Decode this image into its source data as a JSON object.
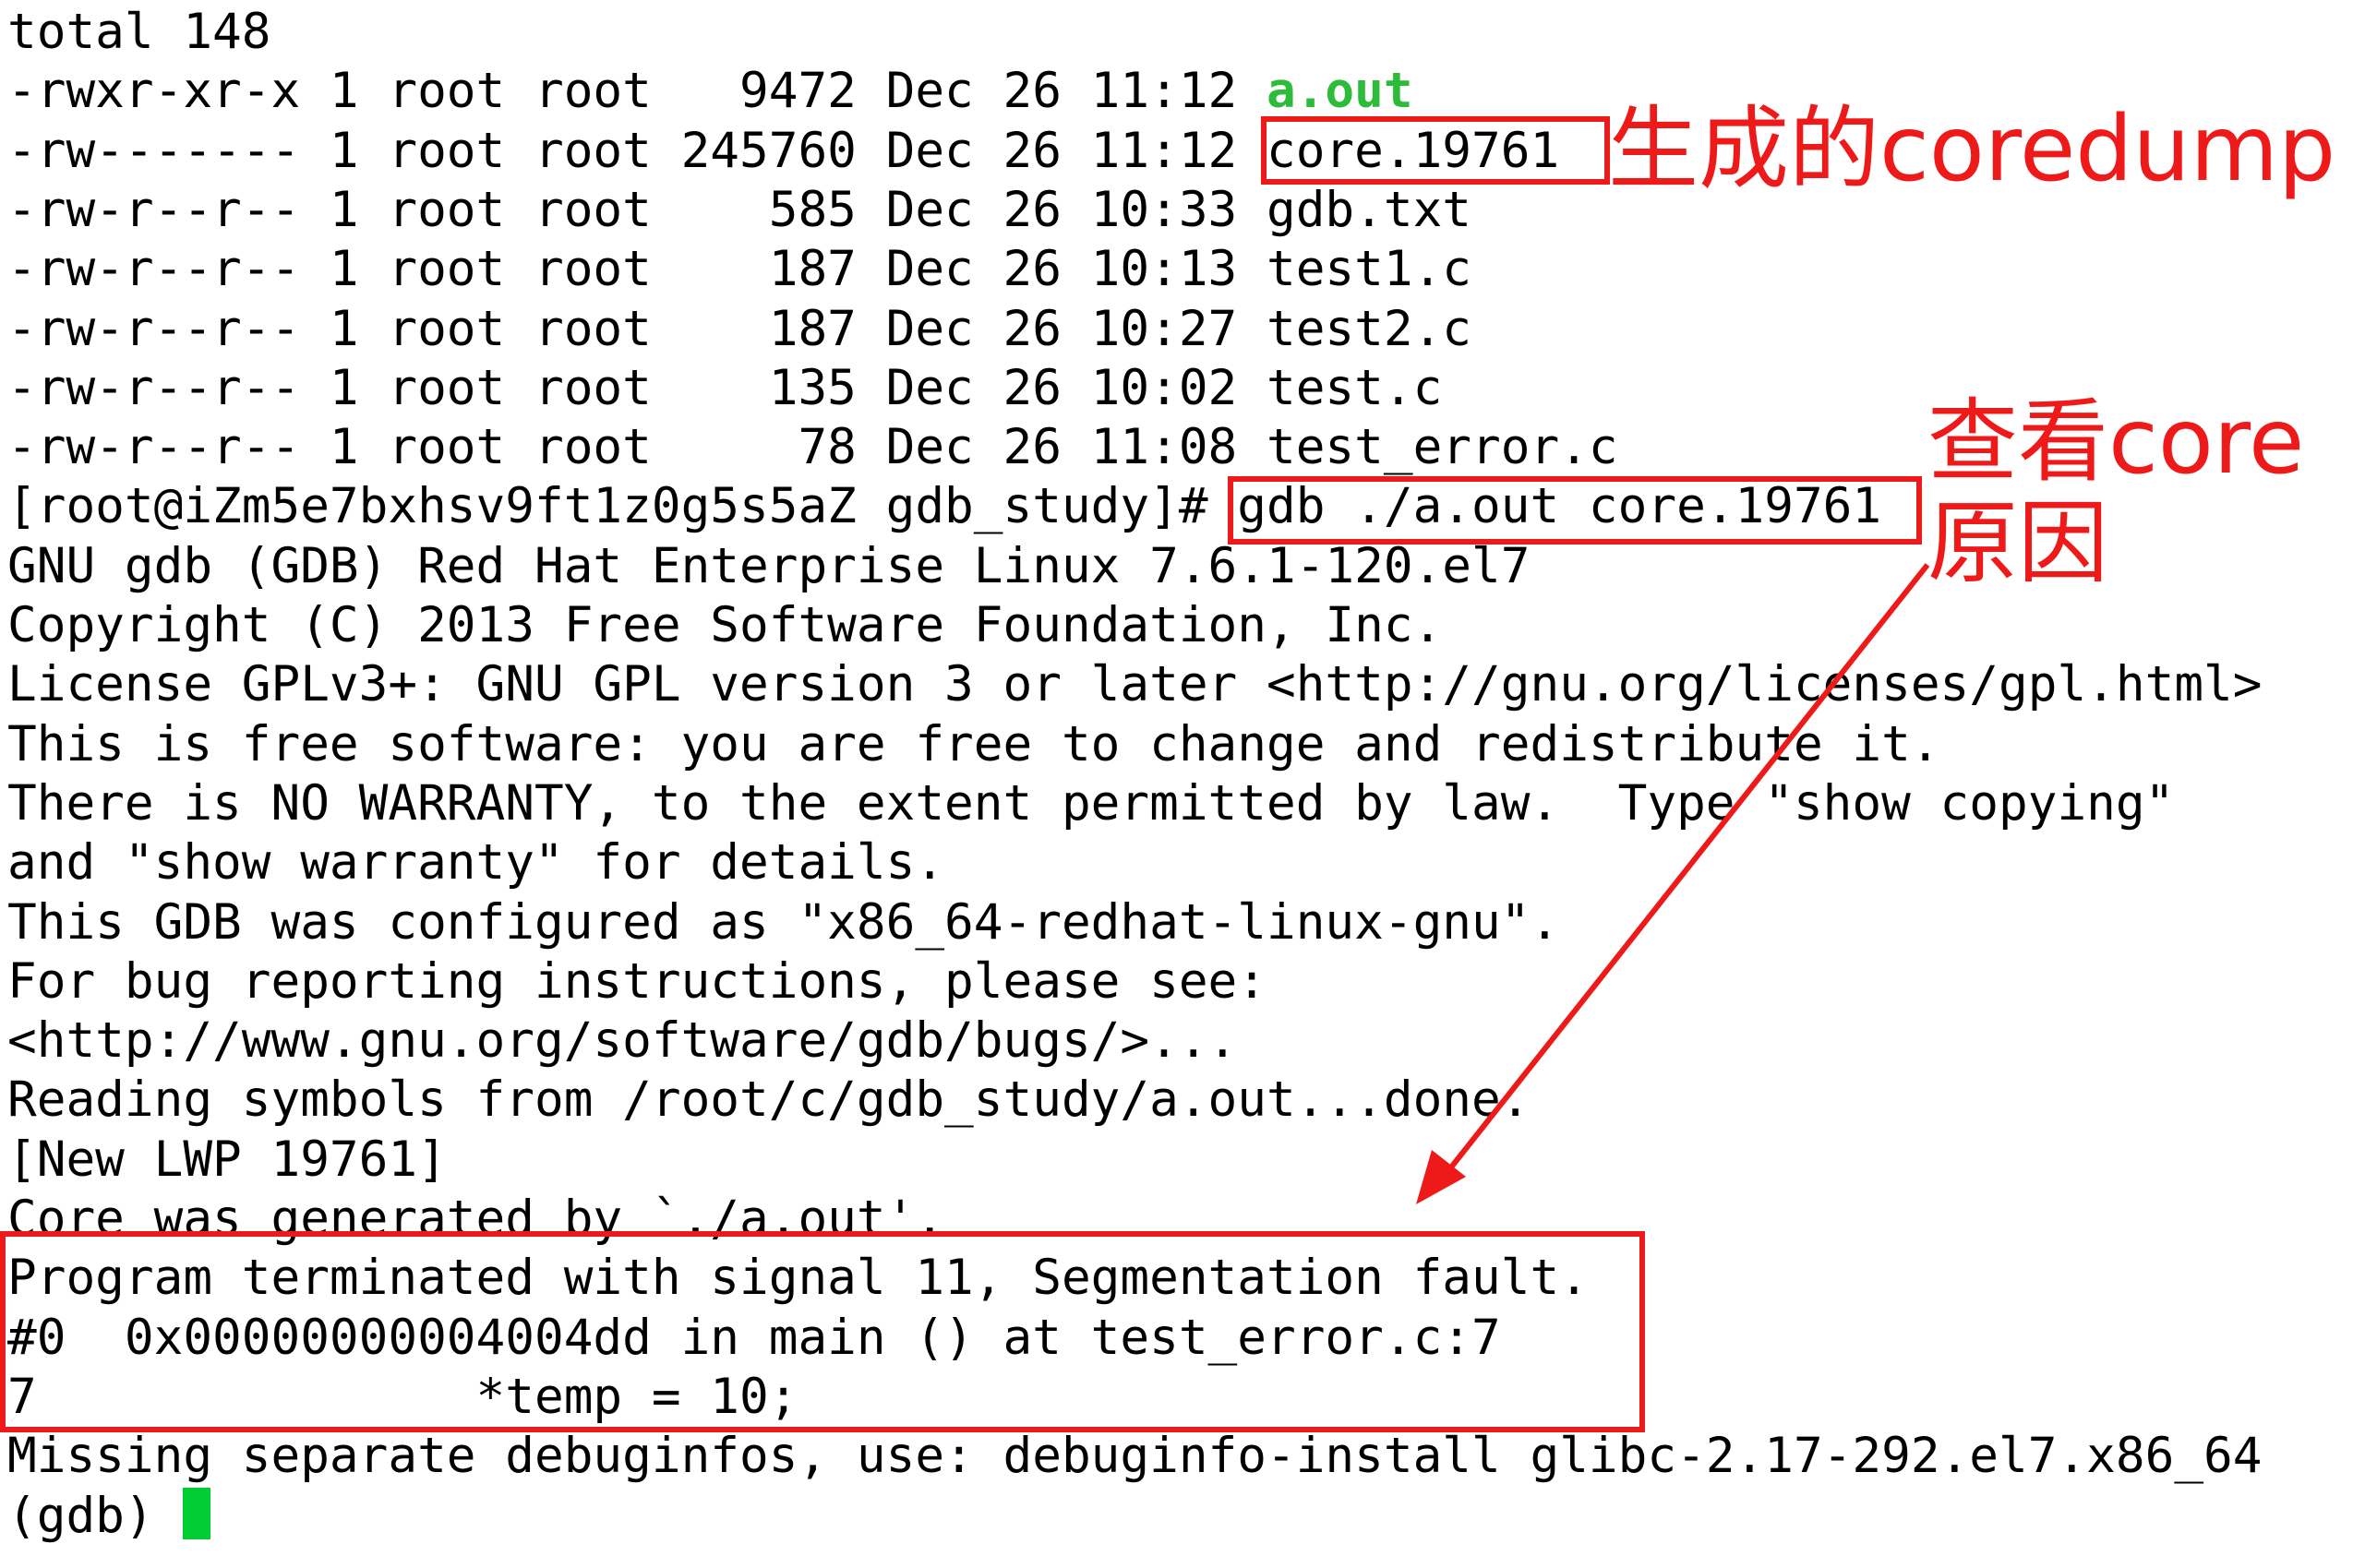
{
  "terminal": {
    "lines": [
      {
        "id": "total",
        "text": "total 148"
      },
      {
        "id": "ls-a-out",
        "text": "-rwxr-xr-x 1 root root   9472 Dec 26 11:12 ",
        "name": "a.out"
      },
      {
        "id": "ls-core",
        "text": "-rw------- 1 root root 245760 Dec 26 11:12 core.19761"
      },
      {
        "id": "ls-gdb-txt",
        "text": "-rw-r--r-- 1 root root    585 Dec 26 10:33 gdb.txt"
      },
      {
        "id": "ls-test1",
        "text": "-rw-r--r-- 1 root root    187 Dec 26 10:13 test1.c"
      },
      {
        "id": "ls-test2",
        "text": "-rw-r--r-- 1 root root    187 Dec 26 10:27 test2.c"
      },
      {
        "id": "ls-test",
        "text": "-rw-r--r-- 1 root root    135 Dec 26 10:02 test.c"
      },
      {
        "id": "ls-test-error",
        "text": "-rw-r--r-- 1 root root     78 Dec 26 11:08 test_error.c"
      },
      {
        "id": "prompt",
        "text": "[root@iZm5e7bxhsv9ft1z0g5s5aZ gdb_study]# gdb ./a.out core.19761"
      },
      {
        "id": "gdb-version",
        "text": "GNU gdb (GDB) Red Hat Enterprise Linux 7.6.1-120.el7"
      },
      {
        "id": "copyright",
        "text": "Copyright (C) 2013 Free Software Foundation, Inc."
      },
      {
        "id": "license",
        "text": "License GPLv3+: GNU GPL version 3 or later <http://gnu.org/licenses/gpl.html>"
      },
      {
        "id": "free-software",
        "text": "This is free software: you are free to change and redistribute it."
      },
      {
        "id": "warranty",
        "text": "There is NO WARRANTY, to the extent permitted by law.  Type \"show copying\""
      },
      {
        "id": "show-warranty",
        "text": "and \"show warranty\" for details."
      },
      {
        "id": "configured",
        "text": "This GDB was configured as \"x86_64-redhat-linux-gnu\"."
      },
      {
        "id": "bug-reporting",
        "text": "For bug reporting instructions, please see:"
      },
      {
        "id": "bugs-url",
        "text": "<http://www.gnu.org/software/gdb/bugs/>..."
      },
      {
        "id": "reading-symbols",
        "text": "Reading symbols from /root/c/gdb_study/a.out...done."
      },
      {
        "id": "new-lwp",
        "text": "[New LWP 19761]"
      },
      {
        "id": "core-generated",
        "text": "Core was generated by `./a.out'."
      },
      {
        "id": "terminated",
        "text": "Program terminated with signal 11, Segmentation fault."
      },
      {
        "id": "frame0",
        "text": "#0  0x00000000004004dd in main () at test_error.c:7"
      },
      {
        "id": "source-line",
        "text": "7\t\t*temp = 10;"
      },
      {
        "id": "missing-debuginfo",
        "text": "Missing separate debuginfos, use: debuginfo-install glibc-2.17-292.el7.x86_64"
      },
      {
        "id": "gdb-prompt",
        "text": "(gdb) "
      }
    ]
  },
  "annotations": {
    "coredump_label": "生成的coredump",
    "view_core_label": "查看core\n原因"
  },
  "colors": {
    "annotation_red": "#ee1a1a",
    "executable_green": "#2dbb3a",
    "cursor_green": "#00cc33",
    "text": "#000000",
    "background": "#ffffff"
  }
}
